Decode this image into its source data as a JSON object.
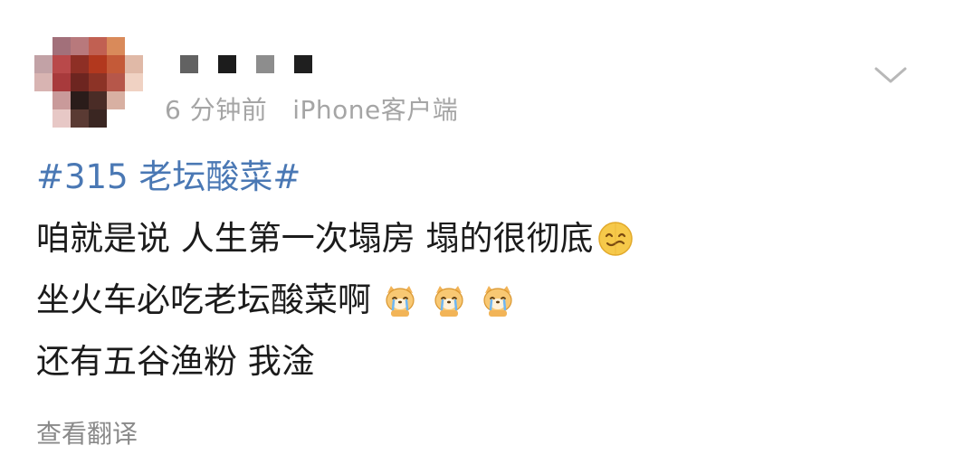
{
  "post": {
    "time": "6 分钟前",
    "source": "iPhone客户端",
    "hashtag": "#315 老坛酸菜#",
    "lines": [
      "咱就是说 人生第一次塌房 塌的很彻底",
      "坐火车必吃老坛酸菜啊",
      "还有五谷渔粉 我淦"
    ],
    "translate_label": "查看翻译"
  },
  "icons": {
    "menu": "chevron-down-icon",
    "emoji_1": "wobbly-smile-emoji",
    "emoji_2": "crying-dog-emoji"
  },
  "colors": {
    "hashtag": "#4a78b4",
    "meta": "#a5a5a5",
    "translate": "#8a8a8a",
    "text": "#1b1b1b"
  }
}
